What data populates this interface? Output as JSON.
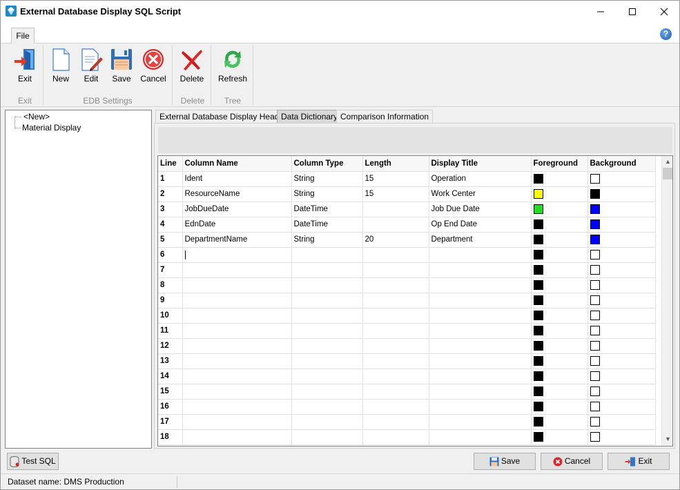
{
  "window": {
    "title": "External Database Display SQL Script"
  },
  "ribbon_tabs": {
    "file": "File"
  },
  "ribbon": {
    "exit": "Exit",
    "new": "New",
    "edit": "Edit",
    "save": "Save",
    "cancel": "Cancel",
    "delete": "Delete",
    "refresh": "Refresh",
    "groups": {
      "exit": "Exit",
      "edb_settings": "EDB Settings",
      "delete": "Delete",
      "tree": "Tree"
    }
  },
  "tree": {
    "items": [
      "<New>",
      "Material Display"
    ]
  },
  "tabs": [
    "External Database Display Header",
    "Data Dictionary",
    "Comparison Information"
  ],
  "grid": {
    "headers": [
      "Line",
      "Column Name",
      "Column Type",
      "Length",
      "Display Title",
      "Foreground",
      "Background"
    ],
    "rows": [
      {
        "line": "1",
        "column_name": "Ident",
        "column_type": "String",
        "length": "15",
        "display_title": "Operation",
        "fg": "#000000",
        "bg": "#ffffff"
      },
      {
        "line": "2",
        "column_name": "ResourceName",
        "column_type": "String",
        "length": "15",
        "display_title": "Work Center",
        "fg": "#ffff00",
        "bg": "#000000"
      },
      {
        "line": "3",
        "column_name": "JobDueDate",
        "column_type": "DateTime",
        "length": "",
        "display_title": "Job Due Date",
        "fg": "#22dd22",
        "bg": "#0000ff"
      },
      {
        "line": "4",
        "column_name": "EdnDate",
        "column_type": "DateTime",
        "length": "",
        "display_title": "Op End Date",
        "fg": "#000000",
        "bg": "#0000ff"
      },
      {
        "line": "5",
        "column_name": "DepartmentName",
        "column_type": "String",
        "length": "20",
        "display_title": "Department",
        "fg": "#000000",
        "bg": "#0000ff"
      },
      {
        "line": "6",
        "column_name": "",
        "column_type": "",
        "length": "",
        "display_title": "",
        "fg": "#000000",
        "bg": "#ffffff"
      },
      {
        "line": "7",
        "column_name": "",
        "column_type": "",
        "length": "",
        "display_title": "",
        "fg": "#000000",
        "bg": "#ffffff"
      },
      {
        "line": "8",
        "column_name": "",
        "column_type": "",
        "length": "",
        "display_title": "",
        "fg": "#000000",
        "bg": "#ffffff"
      },
      {
        "line": "9",
        "column_name": "",
        "column_type": "",
        "length": "",
        "display_title": "",
        "fg": "#000000",
        "bg": "#ffffff"
      },
      {
        "line": "10",
        "column_name": "",
        "column_type": "",
        "length": "",
        "display_title": "",
        "fg": "#000000",
        "bg": "#ffffff"
      },
      {
        "line": "11",
        "column_name": "",
        "column_type": "",
        "length": "",
        "display_title": "",
        "fg": "#000000",
        "bg": "#ffffff"
      },
      {
        "line": "12",
        "column_name": "",
        "column_type": "",
        "length": "",
        "display_title": "",
        "fg": "#000000",
        "bg": "#ffffff"
      },
      {
        "line": "13",
        "column_name": "",
        "column_type": "",
        "length": "",
        "display_title": "",
        "fg": "#000000",
        "bg": "#ffffff"
      },
      {
        "line": "14",
        "column_name": "",
        "column_type": "",
        "length": "",
        "display_title": "",
        "fg": "#000000",
        "bg": "#ffffff"
      },
      {
        "line": "15",
        "column_name": "",
        "column_type": "",
        "length": "",
        "display_title": "",
        "fg": "#000000",
        "bg": "#ffffff"
      },
      {
        "line": "16",
        "column_name": "",
        "column_type": "",
        "length": "",
        "display_title": "",
        "fg": "#000000",
        "bg": "#ffffff"
      },
      {
        "line": "17",
        "column_name": "",
        "column_type": "",
        "length": "",
        "display_title": "",
        "fg": "#000000",
        "bg": "#ffffff"
      },
      {
        "line": "18",
        "column_name": "",
        "column_type": "",
        "length": "",
        "display_title": "",
        "fg": "#000000",
        "bg": "#ffffff"
      }
    ]
  },
  "buttons": {
    "test_sql": "Test SQL",
    "save": "Save",
    "cancel": "Cancel",
    "exit": "Exit"
  },
  "status": {
    "dataset": "Dataset name:  DMS Production"
  }
}
